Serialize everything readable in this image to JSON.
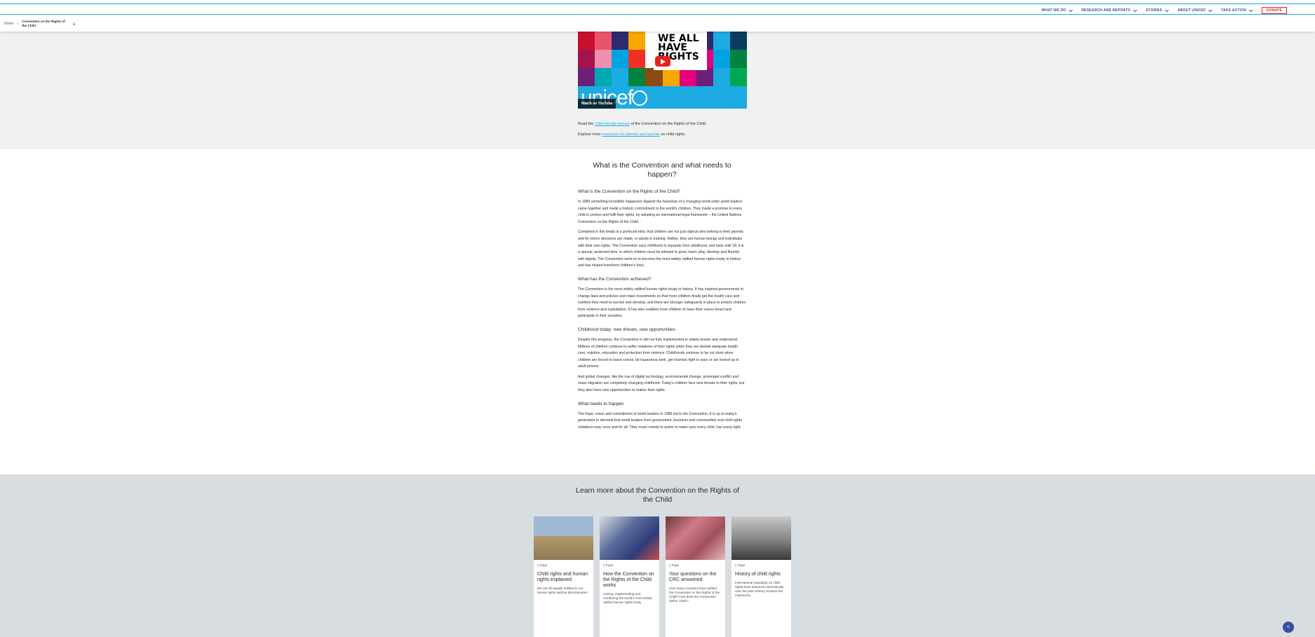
{
  "header": {
    "nav": [
      "WHAT WE DO",
      "RESEARCH AND REPORTS",
      "STORIES",
      "ABOUT UNICEF",
      "TAKE ACTION"
    ],
    "donate": "DONATE"
  },
  "breadcrumb": {
    "home": "Home",
    "separator": "›",
    "current": "Convention on the Rights of the Child",
    "add": "+"
  },
  "video": {
    "card_text": "WE ALL HAVE RIGHTS",
    "brand": "unicef",
    "watch_on": "Watch on",
    "youtube": "YouTube",
    "colors": [
      "#c8102e",
      "#e9546b",
      "#2e2a6e",
      "#f6a800",
      "#ffffff",
      "#ffffff",
      "#00833e",
      "#2e2a6e",
      "#1cabe2",
      "#0b3c5d",
      "#a5124e",
      "#f08fae",
      "#00a3e0",
      "#ee3124",
      "#ffffff",
      "#ffffff",
      "#6d2077",
      "#e4007c",
      "#00a3e0",
      "#00833e",
      "#6d2077",
      "#00a8b5",
      "#1cabe2",
      "#00833e",
      "#8c4a12",
      "#f6a800",
      "#e4007c",
      "#6d2077",
      "#1cabe2",
      "#00a94f"
    ]
  },
  "captions": {
    "line1_pre": "Read the ",
    "line1_link": "child-friendly version",
    "line1_post": " of the Convention on the Rights of the Child.",
    "line2_pre": "Explore more ",
    "line2_link": "resources for parents and teacher",
    "line2_post": " on child rights."
  },
  "article": {
    "title": "What is the Convention and what needs to happen?",
    "h1": "What is the Convention on the Rights of the Child?",
    "p1": "In 1989 something incredible happened. Against the backdrop of a changing world order world leaders came together and made a historic commitment to the world's children. They made a promise to every child to protect and fulfil their rights, by adopting an international legal framework – the United Nations Convention on the Rights of the Child.",
    "p2": "Contained in this treaty is a profound idea: that children are not just objects who belong to their parents and for whom decisions are made, or adults in training. Rather, they are human beings and individuals with their own rights. The Convention says childhood is separate from adulthood, and lasts until 18; it is a special, protected time, in which children must be allowed to grow, learn, play, develop and flourish with dignity. The Convention went on to become the most widely ratified human rights treaty in history and has helped transform children's lives.",
    "h2": "What has the Convention achieved?",
    "p3": "The Convention is the most widely ratified human rights treaty in history. It has inspired governments to change laws and policies and make investments so that more children finally get the health care and nutrition they need to survive and develop, and there are stronger safeguards in place to protect children from violence and exploitation. It has also enabled more children to have their voices heard and participate in their societies.",
    "h3": "Childhood today: new threats, new opportunities",
    "p4": "Despite this progress, the Convention is still not fully implemented or widely known and understood. Millions of children continue to suffer violations of their rights when they are denied adequate health care, nutrition, education and protection from violence. Childhoods continue to be cut short when children are forced to leave school, do hazardous work, get married, fight in wars or are locked up in adult prisons.",
    "p5": "And global changes, like the rise of digital technology, environmental change, prolonged conflict and mass migration are completely changing childhood. Today's children face new threats to their rights, but they also have new opportunities to realize their rights.",
    "h4": "What needs to happen",
    "p6": "The hope, vision and commitment of world leaders in 1989 led to the Convention. It is up to today's generation to demand that world leaders from government, business and communities end child rights violations now, once and for all. They must commit to action to make sure every child, has every right."
  },
  "learn_more": {
    "title": "Learn more about the Convention on the Rights of the Child",
    "cards": [
      {
        "type": "Page",
        "title": "Child rights and human rights explained",
        "desc": "We are all equally entitled to our human rights without discrimination.",
        "thumb": "#b39a6b"
      },
      {
        "type": "Page",
        "title": "How the Convention on the Rights of the Child works",
        "desc": "Joining, implementing and monitoring the world's most widely ratified human rights treaty",
        "thumb": "#5a6b9a"
      },
      {
        "type": "Page",
        "title": "Your questions on the CRC answered",
        "desc": "How many countries have ratified the Convention on the Rights of the Child? How does the Convention define 'child'?",
        "thumb": "#a0505a"
      },
      {
        "type": "Page",
        "title": "History of child rights",
        "desc": "International standards on child rights have advanced dramatically over the past century. Explore the milestones.",
        "thumb": "#8a8a8a"
      }
    ]
  },
  "share": {
    "icon": "share-icon",
    "glyph": "<"
  }
}
